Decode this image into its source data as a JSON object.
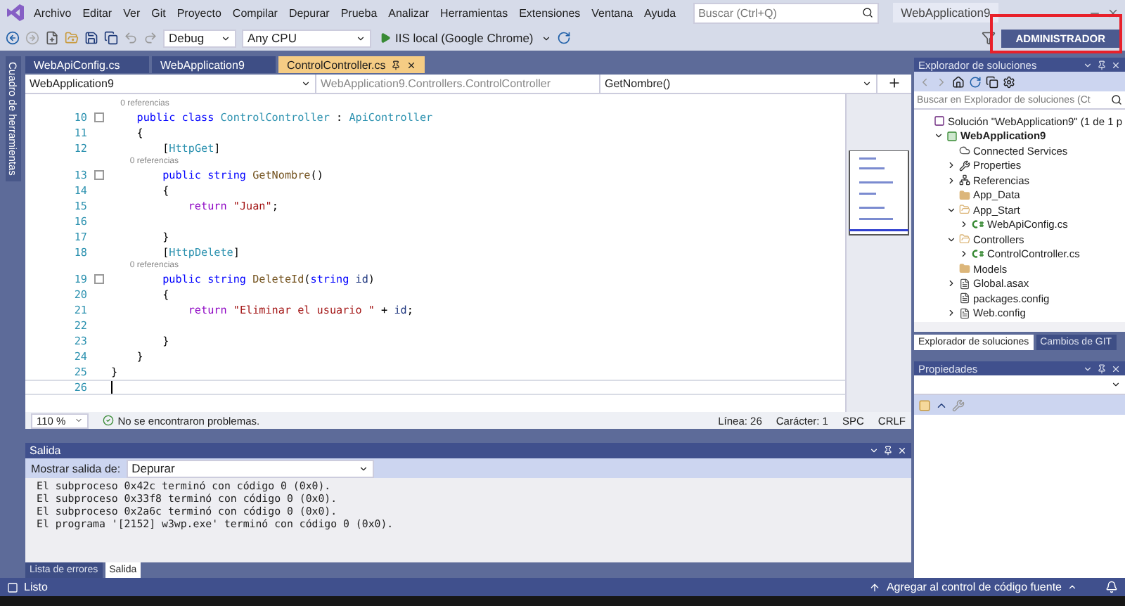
{
  "menu_bar": {
    "items": [
      "Archivo",
      "Editar",
      "Ver",
      "Git",
      "Proyecto",
      "Compilar",
      "Depurar",
      "Prueba",
      "Analizar",
      "Herramientas",
      "Extensiones",
      "Ventana",
      "Ayuda"
    ],
    "search": {
      "placeholder": "Buscar (Ctrl+Q)"
    },
    "solution_name": "WebApplication9"
  },
  "toolbar": {
    "configuration": "Debug",
    "platform": "Any CPU",
    "run_target": "IIS local (Google Chrome)",
    "user_button": "ADMINISTRADOR"
  },
  "toolbox_strip": {
    "label": "Cuadro de herramientas"
  },
  "document_tabs": [
    {
      "label": "WebApiConfig.cs",
      "selected": false
    },
    {
      "label": "WebApplication9",
      "selected": false
    },
    {
      "label": "ControlController.cs",
      "selected": true
    }
  ],
  "navigation_bar": {
    "project": "WebApplication9",
    "class": "WebApplication9.Controllers.ControlController",
    "member": "GetNombre()"
  },
  "editor": {
    "lines": [
      {
        "kind": "lens",
        "text": "    0 referencias"
      },
      {
        "kind": "code",
        "number": "10",
        "fold": true,
        "current": false,
        "tokens": [
          {
            "text": "    public ",
            "kind": "keyword"
          },
          {
            "text": "class ",
            "kind": "keyword"
          },
          {
            "text": "ControlController",
            "kind": "type"
          },
          {
            "text": " : ",
            "kind": "plain"
          },
          {
            "text": "ApiController",
            "kind": "type"
          }
        ]
      },
      {
        "kind": "code",
        "number": "11",
        "fold": false,
        "current": false,
        "tokens": [
          {
            "text": "    {",
            "kind": "plain"
          }
        ]
      },
      {
        "kind": "code",
        "number": "12",
        "fold": false,
        "current": false,
        "tokens": [
          {
            "text": "        [",
            "kind": "plain"
          },
          {
            "text": "HttpGet",
            "kind": "type"
          },
          {
            "text": "]",
            "kind": "plain"
          }
        ]
      },
      {
        "kind": "lens",
        "text": "        0 referencias"
      },
      {
        "kind": "code",
        "number": "13",
        "fold": true,
        "current": false,
        "tokens": [
          {
            "text": "        public ",
            "kind": "keyword"
          },
          {
            "text": "string ",
            "kind": "keyword"
          },
          {
            "text": "GetNombre",
            "kind": "method"
          },
          {
            "text": "()",
            "kind": "plain"
          }
        ]
      },
      {
        "kind": "code",
        "number": "14",
        "fold": false,
        "current": false,
        "tokens": [
          {
            "text": "        {",
            "kind": "plain"
          }
        ]
      },
      {
        "kind": "code",
        "number": "15",
        "fold": false,
        "current": false,
        "tokens": [
          {
            "text": "            return ",
            "kind": "control"
          },
          {
            "text": "\"Juan\"",
            "kind": "string"
          },
          {
            "text": ";",
            "kind": "plain"
          }
        ]
      },
      {
        "kind": "code",
        "number": "16",
        "fold": false,
        "current": false
      },
      {
        "kind": "code",
        "number": "17",
        "fold": false,
        "current": false,
        "tokens": [
          {
            "text": "        }",
            "kind": "plain"
          }
        ]
      },
      {
        "kind": "code",
        "number": "18",
        "fold": false,
        "current": false,
        "tokens": [
          {
            "text": "        [",
            "kind": "plain"
          },
          {
            "text": "HttpDelete",
            "kind": "type"
          },
          {
            "text": "]",
            "kind": "plain"
          }
        ]
      },
      {
        "kind": "lens",
        "text": "        0 referencias"
      },
      {
        "kind": "code",
        "number": "19",
        "fold": true,
        "current": false,
        "tokens": [
          {
            "text": "        public ",
            "kind": "keyword"
          },
          {
            "text": "string ",
            "kind": "keyword"
          },
          {
            "text": "DeleteId",
            "kind": "method"
          },
          {
            "text": "(",
            "kind": "plain"
          },
          {
            "text": "string ",
            "kind": "keyword"
          },
          {
            "text": "id",
            "kind": "param"
          },
          {
            "text": ")",
            "kind": "plain"
          }
        ]
      },
      {
        "kind": "code",
        "number": "20",
        "fold": false,
        "current": false,
        "tokens": [
          {
            "text": "        {",
            "kind": "plain"
          }
        ]
      },
      {
        "kind": "code",
        "number": "21",
        "fold": false,
        "current": false,
        "tokens": [
          {
            "text": "            return ",
            "kind": "control"
          },
          {
            "text": "\"Eliminar el usuario \"",
            "kind": "string"
          },
          {
            "text": " + ",
            "kind": "plain"
          },
          {
            "text": "id",
            "kind": "param"
          },
          {
            "text": ";",
            "kind": "plain"
          }
        ]
      },
      {
        "kind": "code",
        "number": "22",
        "fold": false,
        "current": false
      },
      {
        "kind": "code",
        "number": "23",
        "fold": false,
        "current": false,
        "tokens": [
          {
            "text": "        }",
            "kind": "plain"
          }
        ]
      },
      {
        "kind": "code",
        "number": "24",
        "fold": false,
        "current": false,
        "tokens": [
          {
            "text": "    }",
            "kind": "plain"
          }
        ]
      },
      {
        "kind": "code",
        "number": "25",
        "fold": false,
        "current": false,
        "tokens": [
          {
            "text": "}",
            "kind": "plain"
          }
        ]
      },
      {
        "kind": "code",
        "number": "26",
        "fold": false,
        "current": true
      }
    ]
  },
  "editor_status": {
    "zoom": "110 %",
    "issues": "No se encontraron problemas.",
    "line": "Línea: 26",
    "column": "Carácter: 1",
    "indent": "SPC",
    "line_ending": "CRLF"
  },
  "output_panel": {
    "title": "Salida",
    "source_label": "Mostrar salida de:",
    "source": "Depurar",
    "lines": [
      "El subproceso 0x42c terminó con código 0 (0x0).",
      "El subproceso 0x33f8 terminó con código 0 (0x0).",
      "El subproceso 0x2a6c terminó con código 0 (0x0).",
      "El programa '[2152] w3wp.exe' terminó con código 0 (0x0)."
    ],
    "tabs": [
      {
        "label": "Lista de errores",
        "selected": false
      },
      {
        "label": "Salida",
        "selected": true
      }
    ]
  },
  "solution_explorer": {
    "title": "Explorador de soluciones",
    "search": {
      "placeholder": "Buscar en Explorador de soluciones (Ct"
    },
    "tree": [
      {
        "label": "Solución \"WebApplication9\" (1 de 1 p",
        "kind": "solution",
        "children": [
          {
            "label": "WebApplication9",
            "kind": "project",
            "expanded": true,
            "children": [
              {
                "label": "Connected Services",
                "kind": "connected"
              },
              {
                "label": "Properties",
                "kind": "wrench",
                "expanded": false
              },
              {
                "label": "Referencias",
                "kind": "references",
                "expanded": false
              },
              {
                "label": "App_Data",
                "kind": "folder"
              },
              {
                "label": "App_Start",
                "kind": "folder",
                "expanded": true,
                "children": [
                  {
                    "label": "WebApiConfig.cs",
                    "kind": "csharp",
                    "expanded": false
                  }
                ]
              },
              {
                "label": "Controllers",
                "kind": "folder",
                "expanded": true,
                "children": [
                  {
                    "label": "ControlController.cs",
                    "kind": "csharp",
                    "expanded": false
                  }
                ]
              },
              {
                "label": "Models",
                "kind": "folder"
              },
              {
                "label": "Global.asax",
                "kind": "file",
                "expanded": false
              },
              {
                "label": "packages.config",
                "kind": "file"
              },
              {
                "label": "Web.config",
                "kind": "file",
                "expanded": false
              }
            ]
          }
        ]
      }
    ],
    "tabs": [
      {
        "label": "Explorador de soluciones",
        "selected": true
      },
      {
        "label": "Cambios de GIT",
        "selected": false
      }
    ]
  },
  "properties_panel": {
    "title": "Propiedades"
  },
  "status_bar": {
    "status": "Listo",
    "source_control": "Agregar al control de código fuente"
  }
}
